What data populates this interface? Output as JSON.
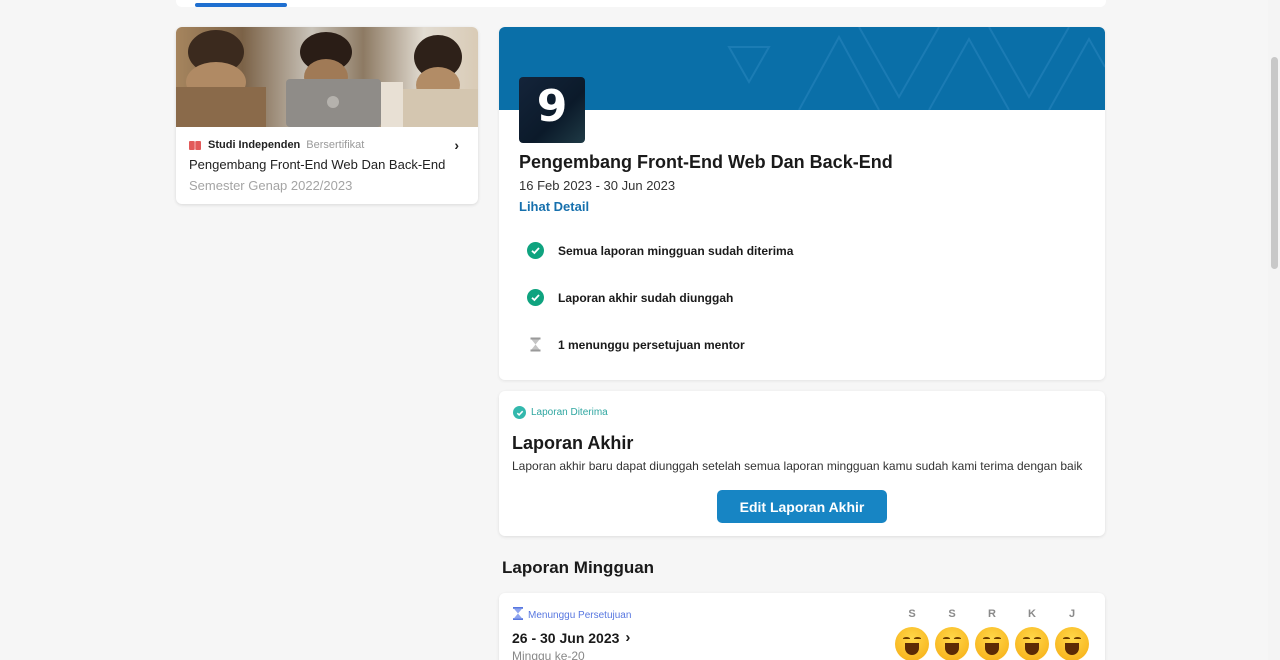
{
  "program_card": {
    "category": "Studi Independen",
    "certificate": "Bersertifikat",
    "name": "Pengembang Front-End Web Dan Back-End",
    "semester": "Semester Genap 2022/2023",
    "icons": {
      "category": "book-icon",
      "open": "chevron-right-icon"
    }
  },
  "program_detail": {
    "logo_letter": "9",
    "title": "Pengembang Front-End Web Dan Back-End",
    "dates": "16 Feb 2023 - 30 Jun 2023",
    "detail_link": "Lihat Detail",
    "statuses": [
      {
        "label": "Semua laporan mingguan sudah diterima",
        "icon": "check-circle-icon"
      },
      {
        "label": "Laporan akhir sudah diunggah",
        "icon": "check-circle-icon"
      },
      {
        "label": "1 menunggu persetujuan mentor",
        "icon": "hourglass-icon"
      }
    ]
  },
  "final_report": {
    "badge": "Laporan Diterima",
    "title": "Laporan Akhir",
    "description": "Laporan akhir baru dapat diunggah setelah semua laporan mingguan kamu sudah kami terima dengan baik",
    "button_label": "Edit Laporan Akhir"
  },
  "weekly_reports": {
    "heading": "Laporan Mingguan",
    "items": [
      {
        "status": "Menunggu Persetujuan",
        "range": "26 - 30 Jun 2023",
        "week": "Minggu ke-20",
        "days": [
          "S",
          "S",
          "R",
          "K",
          "J"
        ]
      }
    ]
  },
  "colors": {
    "accent": "#1785c4",
    "banner": "#0a6fa8",
    "success": "#0fa37f",
    "pending": "#5877e0",
    "link": "#1670ad"
  }
}
